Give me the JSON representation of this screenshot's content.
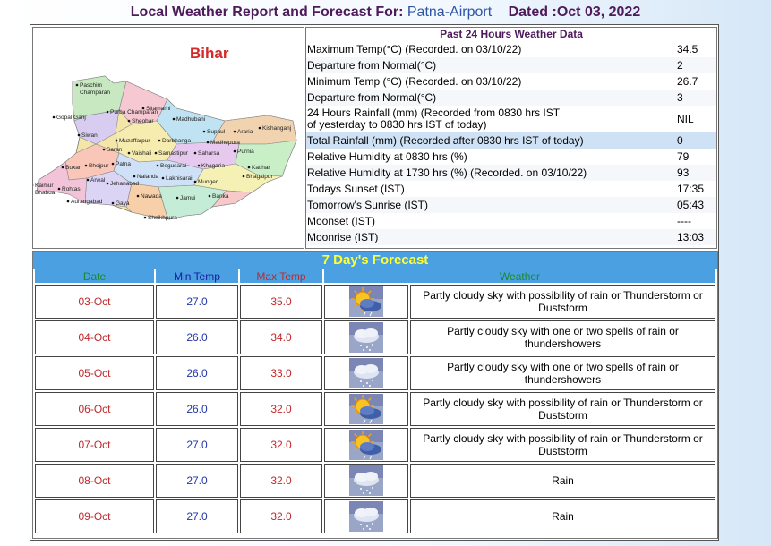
{
  "header": {
    "prefix": "Local Weather Report and Forecast For:",
    "location": "Patna-Airport",
    "dated": "Dated :Oct 03, 2022"
  },
  "map": {
    "state": "Bihar",
    "districts": [
      "Paschim Champaran",
      "Purba Champaran",
      "Sitamarhi",
      "Gopal Ganj",
      "Madhubani",
      "Araria",
      "Kishanganj",
      "Siwan",
      "Sheohar",
      "Supaul",
      "Muzaffarpur",
      "Darbhanga",
      "Madhepura",
      "Purnia",
      "Saran",
      "Vaishali",
      "Samastipur",
      "Saharsa",
      "Katihar",
      "Bhojpur",
      "Patna",
      "Begusarai",
      "Khagaria",
      "Buxar",
      "Nalanda",
      "Lakhisarai",
      "Bhagalpur",
      "Kaimur Bhabua",
      "Rohtas",
      "Arwal",
      "Jehanabad",
      "Munger",
      "Aurangabad",
      "Gaya",
      "Nawada",
      "Jamui",
      "Banka",
      "Sheikhpura"
    ]
  },
  "past24": {
    "title": "Past 24 Hours Weather Data",
    "rows": [
      {
        "label": "Maximum Temp(°C) (Recorded. on 03/10/22)",
        "value": "34.5"
      },
      {
        "label": "Departure from Normal(°C)",
        "value": "2"
      },
      {
        "label": "Minimum Temp (°C) (Recorded. on 03/10/22)",
        "value": "26.7"
      },
      {
        "label": "Departure from Normal(°C)",
        "value": "3"
      },
      {
        "label_line1": "24 Hours Rainfall (mm) (Recorded from 0830 hrs IST",
        "label_line2": "of yesterday to 0830 hrs IST of today)",
        "value": "NIL"
      },
      {
        "label": "Total Rainfall (mm) (Recorded after 0830 hrs IST of today)",
        "value": "0"
      },
      {
        "label": "Relative Humidity at 0830 hrs (%)",
        "value": "79"
      },
      {
        "label": "Relative Humidity at 1730 hrs (%) (Recorded. on 03/10/22)",
        "value": "93"
      },
      {
        "label": "Todays Sunset (IST)",
        "value": "17:35"
      },
      {
        "label": "Tomorrow's Sunrise (IST)",
        "value": "05:43"
      },
      {
        "label": "Moonset (IST)",
        "value": "----"
      },
      {
        "label": "Moonrise (IST)",
        "value": "13:03"
      }
    ]
  },
  "forecast": {
    "title": "7 Day's Forecast",
    "headers": {
      "date": "Date",
      "min": "Min Temp",
      "max": "Max Temp",
      "weather": "Weather"
    },
    "rows": [
      {
        "date": "03-Oct",
        "min": "27.0",
        "max": "35.0",
        "icon": "sun-cloud-rain-icon",
        "weather": "Partly cloudy sky with possibility of rain or Thunderstorm or Duststorm"
      },
      {
        "date": "04-Oct",
        "min": "26.0",
        "max": "34.0",
        "icon": "cloud-rain-icon",
        "weather": "Partly cloudy sky with one or two spells of rain or thundershowers"
      },
      {
        "date": "05-Oct",
        "min": "26.0",
        "max": "33.0",
        "icon": "cloud-rain-icon",
        "weather": "Partly cloudy sky with one or two spells of rain or thundershowers"
      },
      {
        "date": "06-Oct",
        "min": "26.0",
        "max": "32.0",
        "icon": "sun-cloud-rain-icon",
        "weather": "Partly cloudy sky with possibility of rain or Thunderstorm or Duststorm"
      },
      {
        "date": "07-Oct",
        "min": "27.0",
        "max": "32.0",
        "icon": "sun-cloud-rain-icon",
        "weather": "Partly cloudy sky with possibility of rain or Thunderstorm or Duststorm"
      },
      {
        "date": "08-Oct",
        "min": "27.0",
        "max": "32.0",
        "icon": "cloud-rain-icon",
        "weather": "Rain"
      },
      {
        "date": "09-Oct",
        "min": "27.0",
        "max": "32.0",
        "icon": "cloud-rain-icon",
        "weather": "Rain"
      }
    ]
  },
  "colors": {
    "header_purple": "#4d1a5a",
    "location_blue": "#2e55a5",
    "forecast_bar": "#4aa0e0",
    "forecast_title": "#ffff33",
    "date_red": "#c0282b",
    "min_blue": "#2236a8"
  }
}
